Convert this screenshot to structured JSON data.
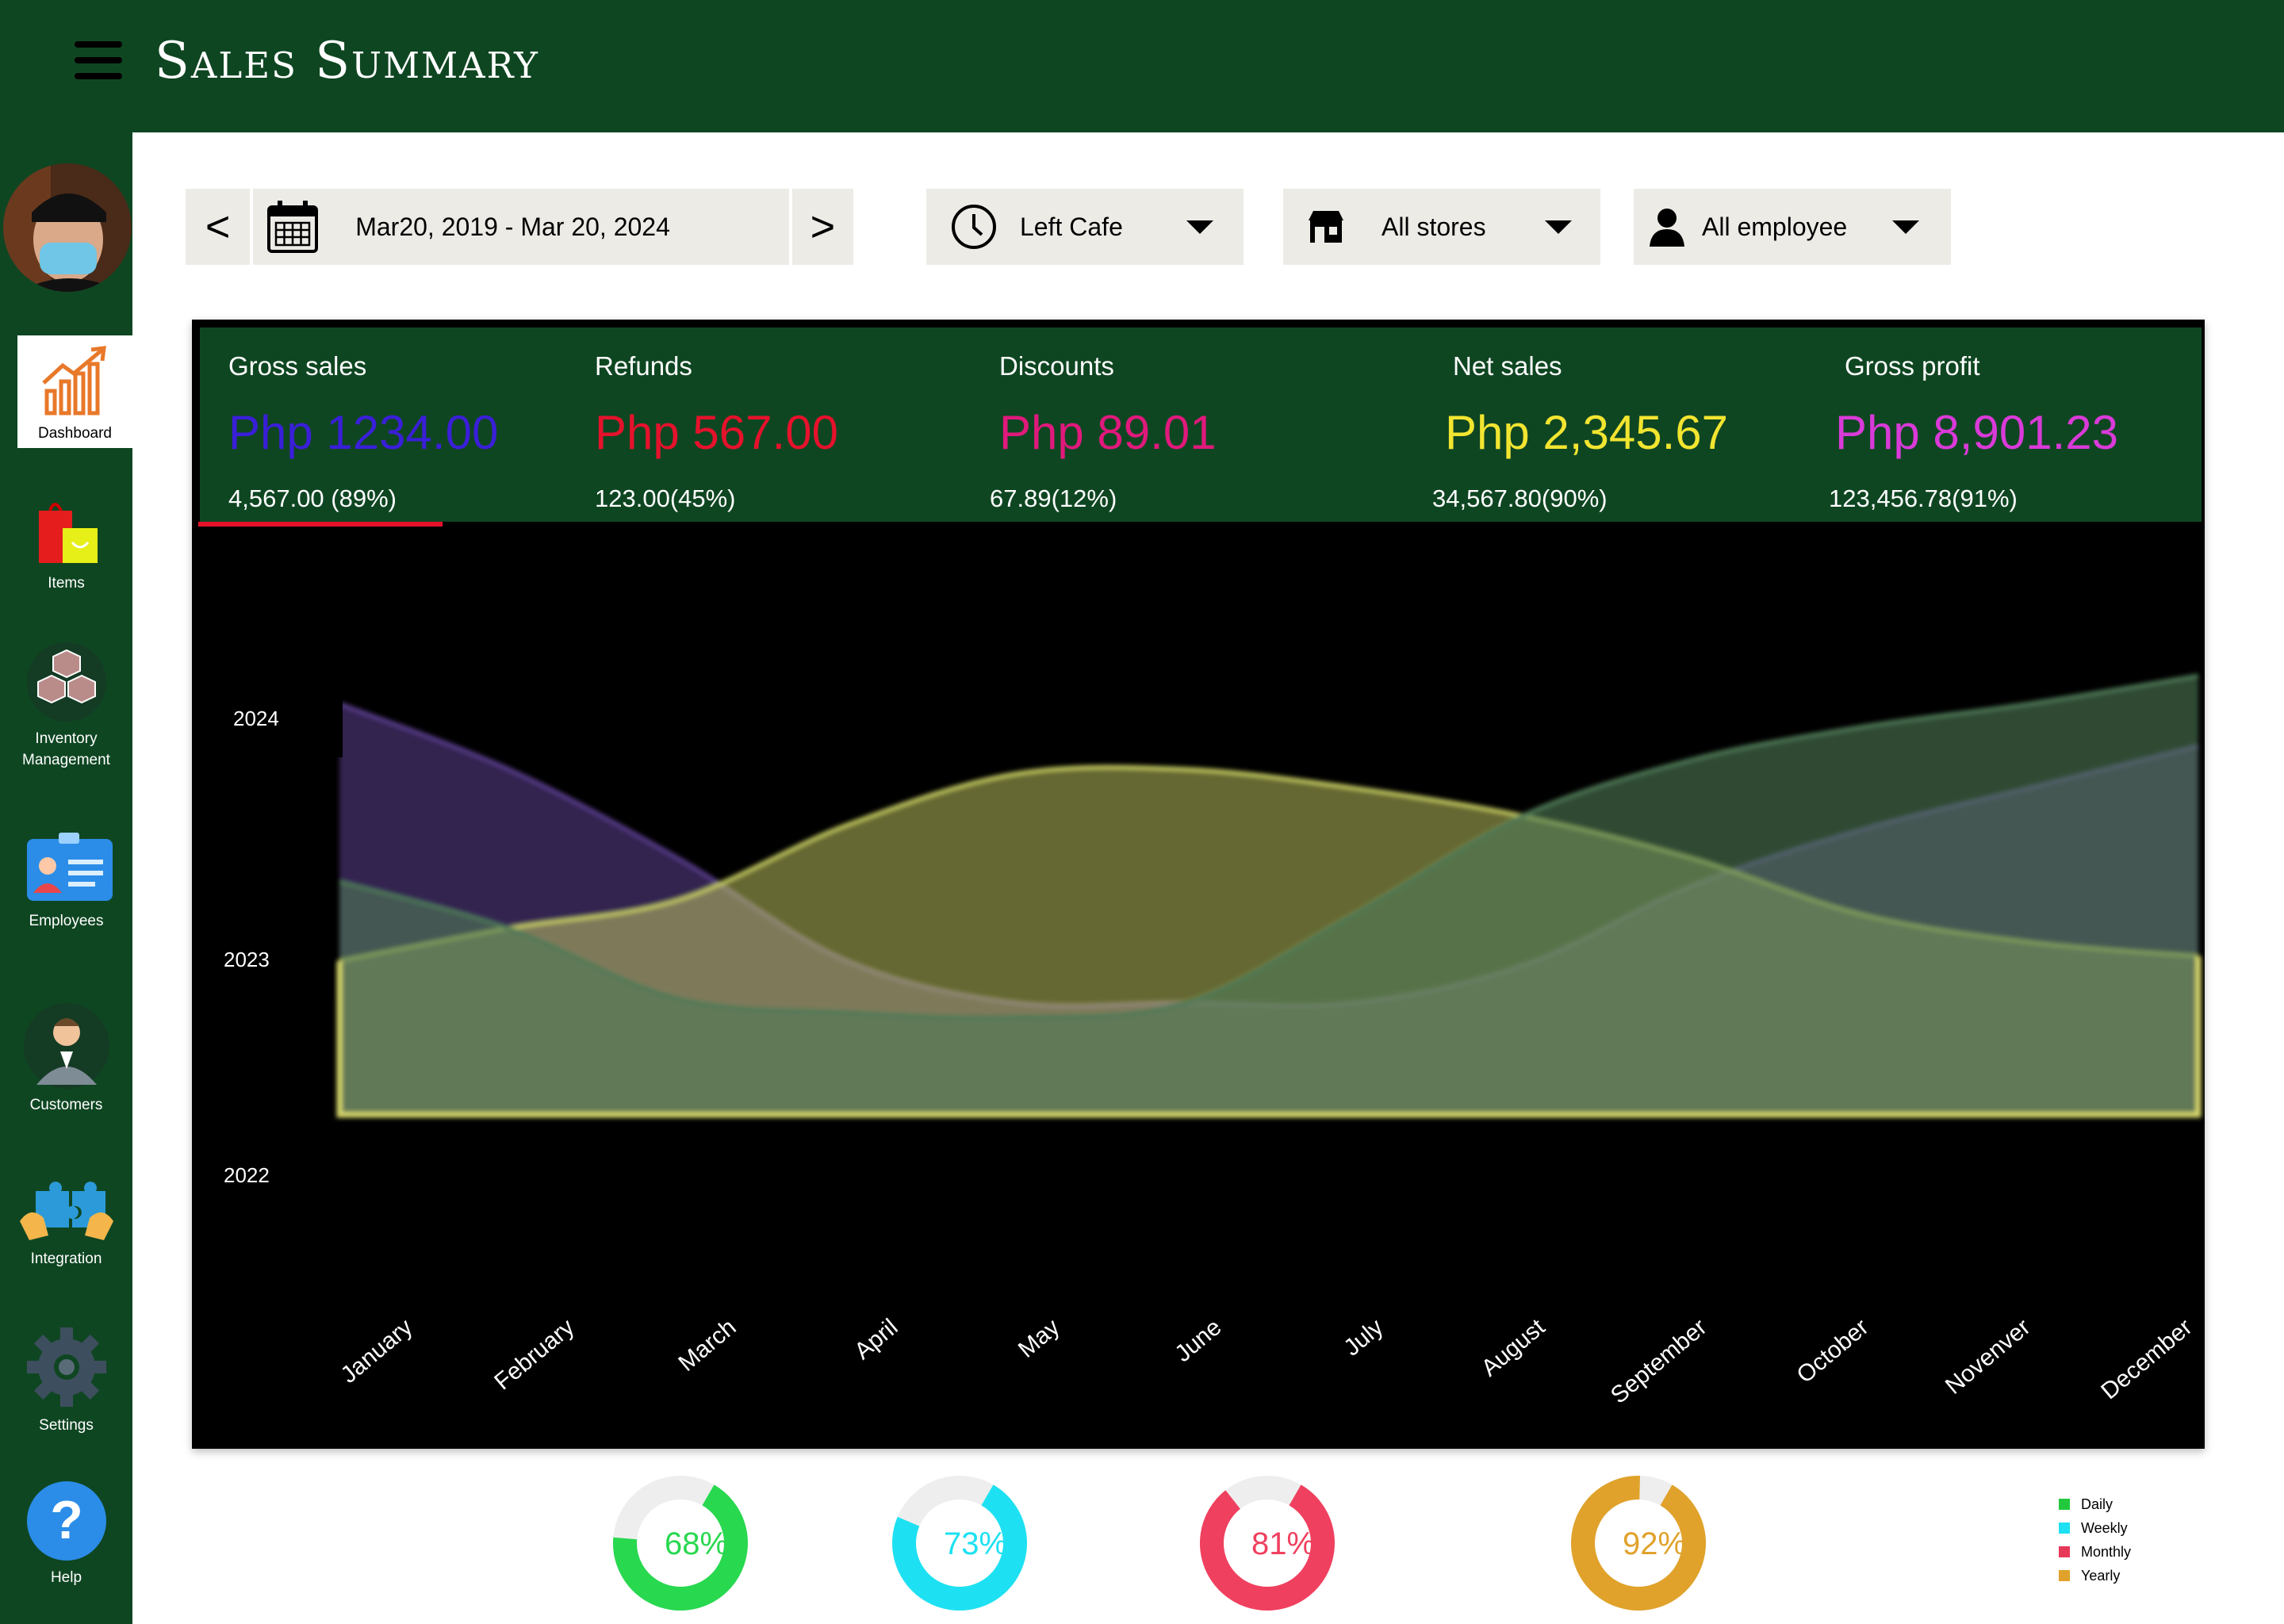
{
  "header": {
    "title": "Sales Summary"
  },
  "sidebar": {
    "items": [
      {
        "label": "Dashboard"
      },
      {
        "label": "Items"
      },
      {
        "label": "Inventory\nManagement"
      },
      {
        "label": "Employees"
      },
      {
        "label": "Customers"
      },
      {
        "label": "Integration"
      },
      {
        "label": "Settings"
      },
      {
        "label": "Help"
      }
    ]
  },
  "filters": {
    "date_range": "Mar20, 2019 - Mar 20, 2024",
    "prev": "<",
    "next": ">",
    "store_location": "Left Cafe",
    "stores": "All stores",
    "employees": "All employee"
  },
  "summary": [
    {
      "label": "Gross sales",
      "value": "Php 1234.00",
      "sub": "4,567.00 (89%)",
      "color": "#3a1fd8"
    },
    {
      "label": "Refunds",
      "value": "Php 567.00",
      "sub": "123.00(45%)",
      "color": "#e5122c"
    },
    {
      "label": "Discounts",
      "value": "Php 89.01",
      "sub": "67.89(12%)",
      "color": "#e0197c"
    },
    {
      "label": "Net sales",
      "value": "Php 2,345.67",
      "sub": "34,567.80(90%)",
      "color": "#f2e530"
    },
    {
      "label": "Gross profit",
      "value": "Php 8,901.23",
      "sub": "123,456.78(91%)",
      "color": "#d93ad8"
    }
  ],
  "chart_data": {
    "type": "area",
    "categories": [
      "January",
      "February",
      "March",
      "April",
      "May",
      "June",
      "July",
      "August",
      "September",
      "October",
      "Novenver",
      "December"
    ],
    "y_labels": [
      "2024",
      "2023",
      "2022"
    ],
    "series": [
      {
        "color": "#5b3f8f",
        "values": [
          0.88,
          0.74,
          0.55,
          0.33,
          0.24,
          0.24,
          0.24,
          0.32,
          0.49,
          0.61,
          0.7,
          0.79
        ]
      },
      {
        "color": "#c9cf63",
        "values": [
          0.33,
          0.4,
          0.46,
          0.62,
          0.73,
          0.74,
          0.7,
          0.64,
          0.55,
          0.43,
          0.37,
          0.34
        ]
      },
      {
        "color": "#4f7a56",
        "values": [
          0.5,
          0.4,
          0.25,
          0.22,
          0.21,
          0.24,
          0.43,
          0.64,
          0.76,
          0.83,
          0.88,
          0.94
        ]
      }
    ]
  },
  "gauges": [
    {
      "label": "68%",
      "value": 0.68,
      "color": "#28d84f"
    },
    {
      "label": "73%",
      "value": 0.73,
      "color": "#1de1f2"
    },
    {
      "label": "81%",
      "value": 0.81,
      "color": "#f0405f"
    },
    {
      "label": "92%",
      "value": 0.92,
      "color": "#e0a22b"
    }
  ],
  "legend": [
    {
      "label": "Daily",
      "color": "#22c93c"
    },
    {
      "label": "Weekly",
      "color": "#1de1f2"
    },
    {
      "label": "Monthly",
      "color": "#e8385a"
    },
    {
      "label": "Yearly",
      "color": "#e0a22b"
    }
  ]
}
